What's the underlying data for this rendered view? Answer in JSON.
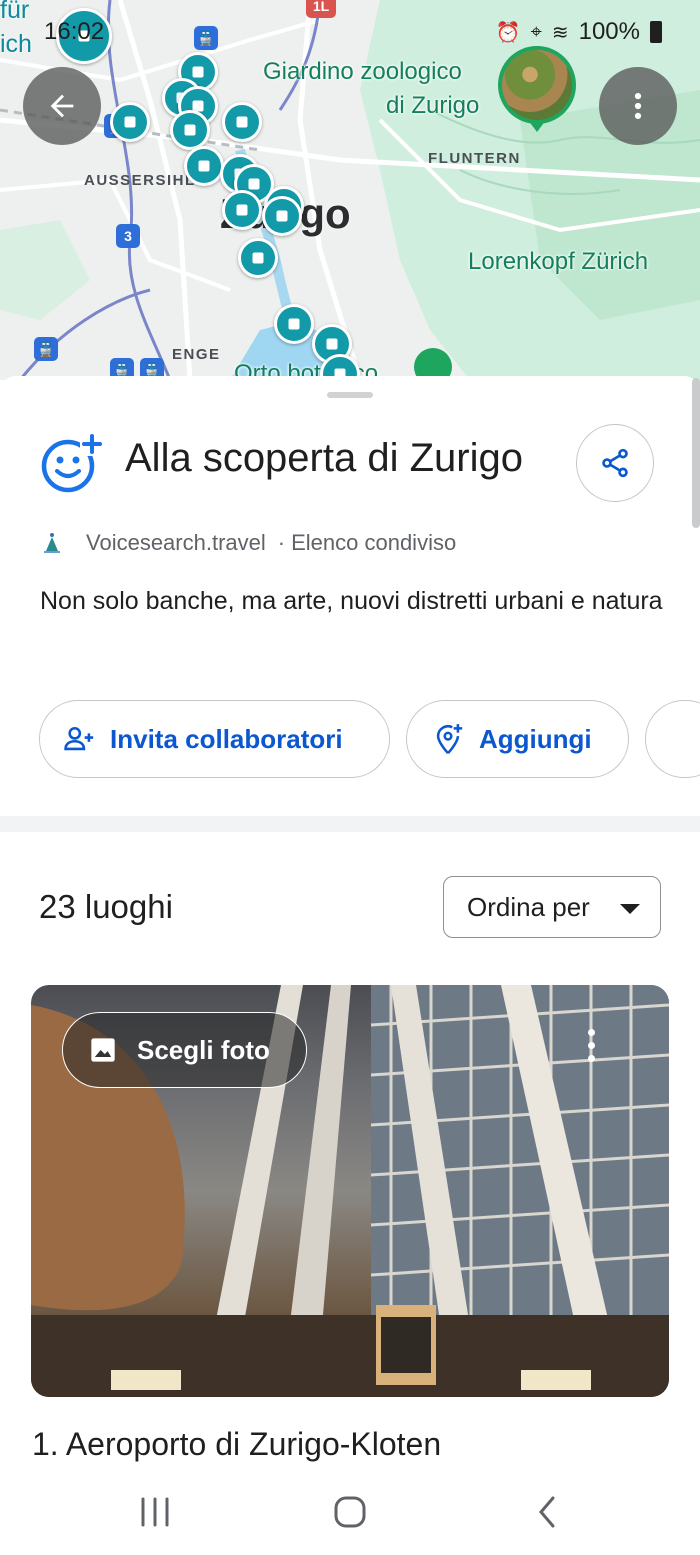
{
  "status_bar": {
    "time": "16:02",
    "battery": "100%"
  },
  "map": {
    "labels": {
      "corner_top": "für",
      "corner_bottom": "ich",
      "zoo_line1": "Giardino zoologico",
      "zoo_line2": "di Zurigo",
      "fluntern": "FLUNTERN",
      "aussersihl": "AUSSERSIHL",
      "city": "Zurigo",
      "loorenkopf": "Lorenkopf Zürich",
      "enge": "ENGE",
      "orto": "Orto botanico",
      "road_marker_3": "3",
      "road_marker_1l": "1L"
    }
  },
  "list": {
    "title": "Alla scoperta di Zurigo",
    "source": "Voicesearch.travel",
    "separator": "·",
    "type": "Elenco condiviso",
    "description": "Non solo banche, ma arte, nuovi distretti urbani e natura",
    "actions": {
      "invite": "Invita collaboratori",
      "add": "Aggiungi"
    },
    "places_count": "23 luoghi",
    "sort_label": "Ordina per",
    "photo_button": "Scegli foto",
    "first_place": "1. Aeroporto di Zurigo-Kloten"
  },
  "colors": {
    "accent_blue": "#0b57d0",
    "pin_teal": "#139aa8",
    "park_green": "#1ea55e"
  }
}
